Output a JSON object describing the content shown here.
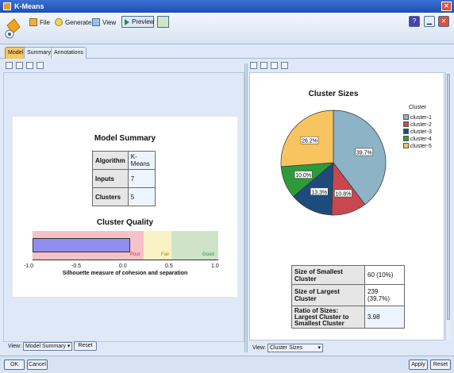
{
  "window": {
    "title": "K-Means"
  },
  "toolbar": {
    "file": "File",
    "generate": "Generate",
    "view": "View",
    "preview": "Preview"
  },
  "tabs": [
    "Model",
    "Summary",
    "Annotations"
  ],
  "model_summary": {
    "title": "Model Summary",
    "rows": [
      {
        "key": "Algorithm",
        "value": "K-Means"
      },
      {
        "key": "Inputs",
        "value": "7"
      },
      {
        "key": "Clusters",
        "value": "5"
      }
    ]
  },
  "cluster_quality": {
    "title": "Cluster Quality",
    "zones": [
      "Poor",
      "Fair",
      "Good"
    ],
    "ticks": [
      "-1.0",
      "-0.5",
      "0.0",
      "0.5",
      "1.0"
    ],
    "xlabel": "Silhouette measure of cohesion and separation",
    "value": 0.05,
    "colors": {
      "poor": "#f4c2c8",
      "fair": "#f8f2c4",
      "good": "#cfe3c9",
      "bar": "#8f8ef0"
    }
  },
  "left_view": {
    "label": "View:",
    "selected": "Model Summary",
    "reset": "Reset"
  },
  "chart_data": {
    "type": "pie",
    "title": "Cluster Sizes",
    "legend_title": "Cluster",
    "legend_position": "right",
    "categories": [
      "cluster-1",
      "cluster-2",
      "cluster-3",
      "cluster-4",
      "cluster-5"
    ],
    "values": [
      39.7,
      10.8,
      13.3,
      10.0,
      26.2
    ],
    "labels": [
      "39.7%",
      "10.8%",
      "13.3%",
      "10.0%",
      "26.2%"
    ],
    "colors": [
      "#8db3c7",
      "#c9484f",
      "#1d4c7c",
      "#2e9b3a",
      "#f7c45f"
    ]
  },
  "size_stats": {
    "rows": [
      {
        "key": "Size of Smallest Cluster",
        "value": "60 (10%)"
      },
      {
        "key": "Size of Largest Cluster",
        "value": "239 (39.7%)"
      },
      {
        "key": "Ratio of Sizes: Largest Cluster to Smallest Cluster",
        "value": "3.98"
      }
    ]
  },
  "right_view": {
    "label": "View:",
    "selected": "Cluster Sizes"
  },
  "footer": {
    "ok": "OK",
    "cancel": "Cancel",
    "apply": "Apply",
    "reset": "Reset"
  }
}
